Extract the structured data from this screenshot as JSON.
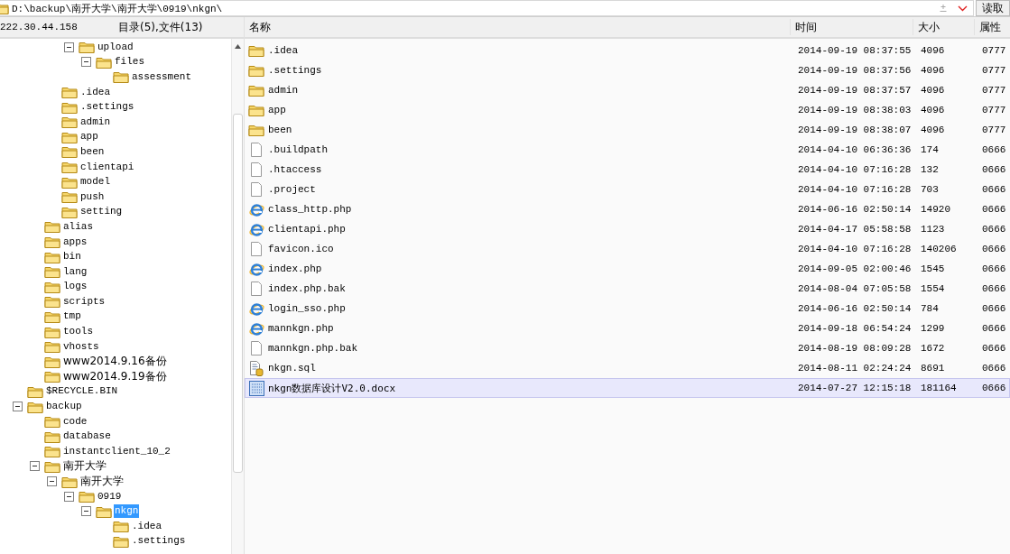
{
  "path_bar": {
    "path": "D:\\backup\\南开大学\\南开大学\\0919\\nkgn\\",
    "read_button": "读取"
  },
  "tree": {
    "host": "222.30.44.158",
    "summary": "目录(5),文件(13)",
    "nodes": [
      {
        "children": [
          {
            "children": [
              {
                "children": [
                  {
                    "label": "upload",
                    "expanded": true,
                    "selected": false,
                    "children": [
                      {
                        "label": "files",
                        "expanded": true,
                        "selected": false,
                        "children": [
                          {
                            "label": "assessment",
                            "selected": false
                          }
                        ]
                      }
                    ]
                  }
                ]
              },
              {
                "label": ".idea",
                "selected": false
              },
              {
                "label": ".settings",
                "selected": false
              },
              {
                "label": "admin",
                "selected": false
              },
              {
                "label": "app",
                "selected": false
              },
              {
                "label": "been",
                "selected": false
              },
              {
                "label": "clientapi",
                "selected": false
              },
              {
                "label": "model",
                "selected": false
              },
              {
                "label": "push",
                "selected": false
              },
              {
                "label": "setting",
                "selected": false
              }
            ]
          },
          {
            "label": "alias",
            "selected": false
          },
          {
            "label": "apps",
            "selected": false
          },
          {
            "label": "bin",
            "selected": false
          },
          {
            "label": "lang",
            "selected": false
          },
          {
            "label": "logs",
            "selected": false
          },
          {
            "label": "scripts",
            "selected": false
          },
          {
            "label": "tmp",
            "selected": false
          },
          {
            "label": "tools",
            "selected": false
          },
          {
            "label": "vhosts",
            "selected": false
          },
          {
            "label": "www2014.9.16备份",
            "selected": false
          },
          {
            "label": "www2014.9.19备份",
            "selected": false
          }
        ]
      },
      {
        "label": "$RECYCLE.BIN",
        "selected": false
      },
      {
        "label": "backup",
        "expanded": true,
        "selected": false,
        "children": [
          {
            "label": "code",
            "selected": false
          },
          {
            "label": "database",
            "selected": false
          },
          {
            "label": "instantclient_10_2",
            "selected": false
          },
          {
            "label": "南开大学",
            "expanded": true,
            "selected": false,
            "children": [
              {
                "label": "南开大学",
                "expanded": true,
                "selected": false,
                "children": [
                  {
                    "label": "0919",
                    "expanded": true,
                    "selected": false,
                    "children": [
                      {
                        "label": "nkgn",
                        "expanded": true,
                        "selected": true,
                        "children": [
                          {
                            "label": ".idea",
                            "selected": false
                          },
                          {
                            "label": ".settings",
                            "selected": false
                          }
                        ]
                      }
                    ]
                  }
                ]
              }
            ]
          }
        ]
      }
    ]
  },
  "file_list": {
    "columns": [
      "名称",
      "时间",
      "大小",
      "属性"
    ],
    "rows": [
      {
        "kind": "folder",
        "name": ".idea",
        "time": "2014-09-19 08:37:55",
        "size": "4096",
        "mode": "0777",
        "selected": false
      },
      {
        "kind": "folder",
        "name": ".settings",
        "time": "2014-09-19 08:37:56",
        "size": "4096",
        "mode": "0777",
        "selected": false
      },
      {
        "kind": "folder",
        "name": "admin",
        "time": "2014-09-19 08:37:57",
        "size": "4096",
        "mode": "0777",
        "selected": false
      },
      {
        "kind": "folder",
        "name": "app",
        "time": "2014-09-19 08:38:03",
        "size": "4096",
        "mode": "0777",
        "selected": false
      },
      {
        "kind": "folder",
        "name": "been",
        "time": "2014-09-19 08:38:07",
        "size": "4096",
        "mode": "0777",
        "selected": false
      },
      {
        "kind": "file",
        "name": ".buildpath",
        "time": "2014-04-10 06:36:36",
        "size": "174",
        "mode": "0666",
        "selected": false
      },
      {
        "kind": "file",
        "name": ".htaccess",
        "time": "2014-04-10 07:16:28",
        "size": "132",
        "mode": "0666",
        "selected": false
      },
      {
        "kind": "file",
        "name": ".project",
        "time": "2014-04-10 07:16:28",
        "size": "703",
        "mode": "0666",
        "selected": false
      },
      {
        "kind": "web",
        "name": "class_http.php",
        "time": "2014-06-16 02:50:14",
        "size": "14920",
        "mode": "0666",
        "selected": false
      },
      {
        "kind": "web",
        "name": "clientapi.php",
        "time": "2014-04-17 05:58:58",
        "size": "1123",
        "mode": "0666",
        "selected": false
      },
      {
        "kind": "file",
        "name": "favicon.ico",
        "time": "2014-04-10 07:16:28",
        "size": "140206",
        "mode": "0666",
        "selected": false
      },
      {
        "kind": "web",
        "name": "index.php",
        "time": "2014-09-05 02:00:46",
        "size": "1545",
        "mode": "0666",
        "selected": false
      },
      {
        "kind": "file",
        "name": "index.php.bak",
        "time": "2014-08-04 07:05:58",
        "size": "1554",
        "mode": "0666",
        "selected": false
      },
      {
        "kind": "web",
        "name": "login_sso.php",
        "time": "2014-06-16 02:50:14",
        "size": "784",
        "mode": "0666",
        "selected": false
      },
      {
        "kind": "web",
        "name": "mannkgn.php",
        "time": "2014-09-18 06:54:24",
        "size": "1299",
        "mode": "0666",
        "selected": false
      },
      {
        "kind": "file",
        "name": "mannkgn.php.bak",
        "time": "2014-08-19 08:09:28",
        "size": "1672",
        "mode": "0666",
        "selected": false
      },
      {
        "kind": "sql",
        "name": "nkgn.sql",
        "time": "2014-08-11 02:24:24",
        "size": "8691",
        "mode": "0666",
        "selected": false
      },
      {
        "kind": "doc",
        "name": "nkgn数据库设计V2.0.docx",
        "time": "2014-07-27 12:15:18",
        "size": "181164",
        "mode": "0666",
        "selected": true
      }
    ]
  }
}
